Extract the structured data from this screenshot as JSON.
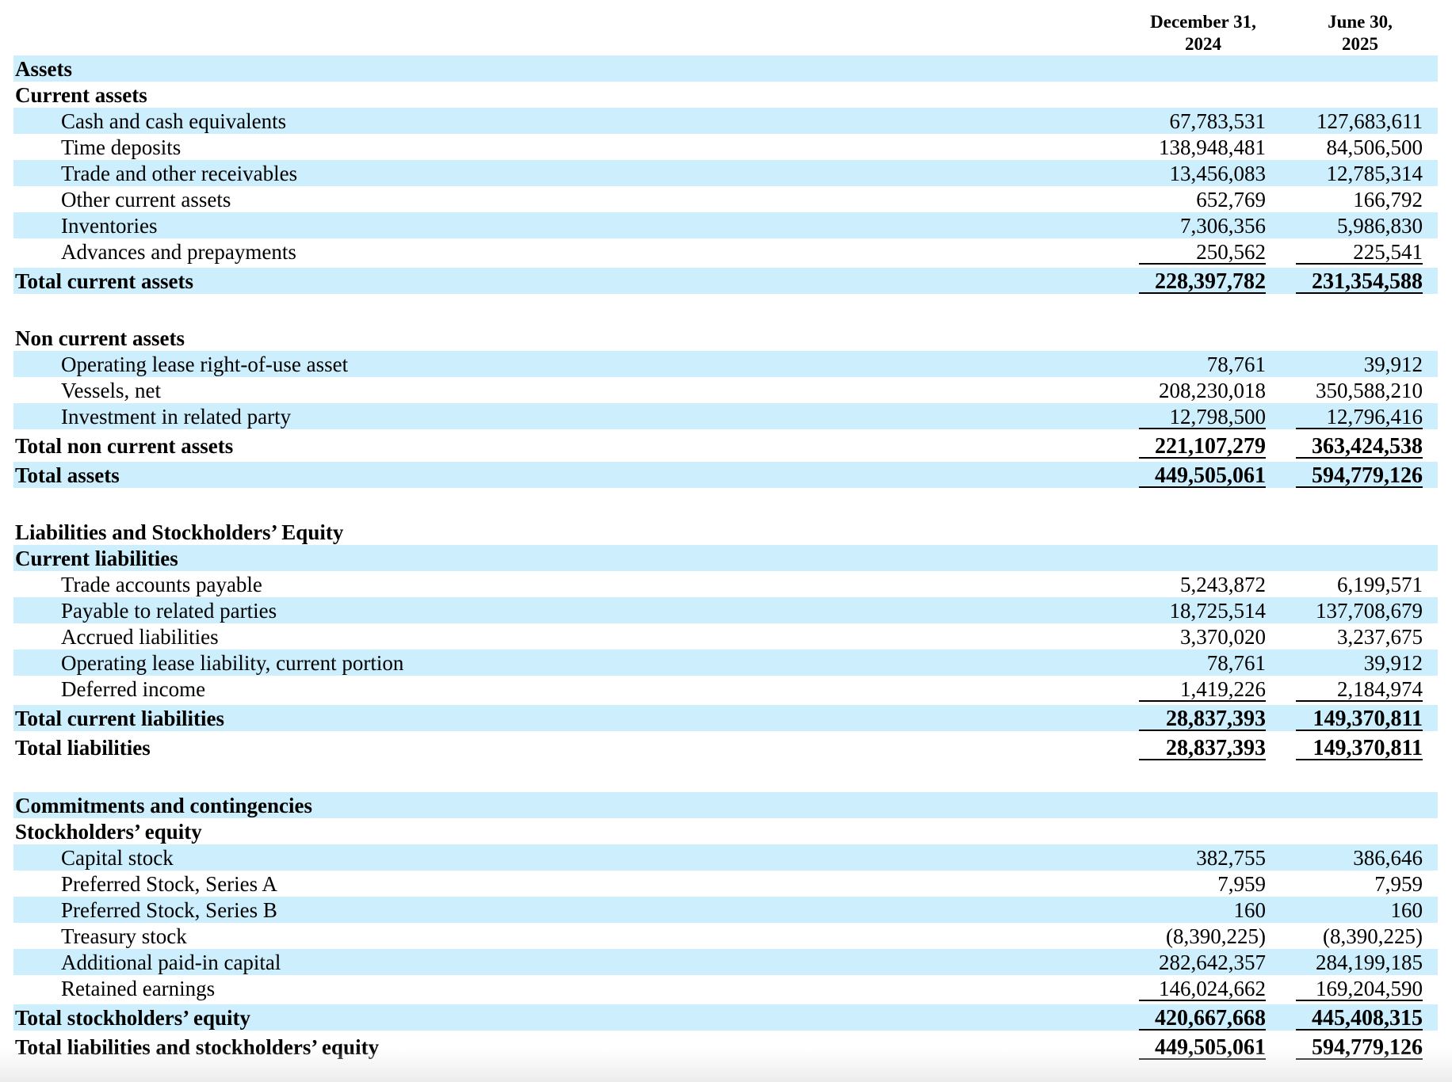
{
  "columns": [
    "December 31,\n2024",
    "June 30,\n2025"
  ],
  "column_lines": [
    [
      "December 31,",
      "2024"
    ],
    [
      "June 30,",
      "2025"
    ]
  ],
  "rows": [
    {
      "label": "Assets",
      "v1": "",
      "v2": ""
    },
    {
      "label": "Current assets",
      "v1": "",
      "v2": ""
    },
    {
      "label": "Cash and cash equivalents",
      "v1": "67,783,531",
      "v2": "127,683,611"
    },
    {
      "label": "Time deposits",
      "v1": "138,948,481",
      "v2": "84,506,500"
    },
    {
      "label": "Trade and other receivables",
      "v1": "13,456,083",
      "v2": "12,785,314"
    },
    {
      "label": "Other current assets",
      "v1": "652,769",
      "v2": "166,792"
    },
    {
      "label": "Inventories",
      "v1": "7,306,356",
      "v2": "5,986,830"
    },
    {
      "label": "Advances and prepayments",
      "v1": "250,562",
      "v2": "225,541"
    },
    {
      "label": "Total current assets",
      "v1": "228,397,782",
      "v2": "231,354,588"
    },
    {
      "label": "Non current assets",
      "v1": "",
      "v2": ""
    },
    {
      "label": "Operating lease right-of-use asset",
      "v1": "78,761",
      "v2": "39,912"
    },
    {
      "label": "Vessels, net",
      "v1": "208,230,018",
      "v2": "350,588,210"
    },
    {
      "label": "Investment in related party",
      "v1": "12,798,500",
      "v2": "12,796,416"
    },
    {
      "label": "Total non current assets",
      "v1": "221,107,279",
      "v2": "363,424,538"
    },
    {
      "label": "Total assets",
      "v1": "449,505,061",
      "v2": "594,779,126"
    },
    {
      "label": "Liabilities and Stockholders’ Equity",
      "v1": "",
      "v2": ""
    },
    {
      "label": "Current liabilities",
      "v1": "",
      "v2": ""
    },
    {
      "label": "Trade accounts payable",
      "v1": "5,243,872",
      "v2": "6,199,571"
    },
    {
      "label": "Payable to related parties",
      "v1": "18,725,514",
      "v2": "137,708,679"
    },
    {
      "label": "Accrued liabilities",
      "v1": "3,370,020",
      "v2": "3,237,675"
    },
    {
      "label": "Operating lease liability, current portion",
      "v1": "78,761",
      "v2": "39,912"
    },
    {
      "label": "Deferred income",
      "v1": "1,419,226",
      "v2": "2,184,974"
    },
    {
      "label": "Total current liabilities",
      "v1": "28,837,393",
      "v2": "149,370,811"
    },
    {
      "label": "Total liabilities",
      "v1": "28,837,393",
      "v2": "149,370,811"
    },
    {
      "label": "Commitments and contingencies",
      "v1": "",
      "v2": ""
    },
    {
      "label": "Stockholders’ equity",
      "v1": "",
      "v2": ""
    },
    {
      "label": "Capital stock",
      "v1": "382,755",
      "v2": "386,646"
    },
    {
      "label": "Preferred Stock, Series A",
      "v1": "7,959",
      "v2": "7,959"
    },
    {
      "label": "Preferred Stock, Series B",
      "v1": "160",
      "v2": "160"
    },
    {
      "label": "Treasury stock",
      "v1": "(8,390,225)",
      "v2": "(8,390,225)"
    },
    {
      "label": "Additional paid-in capital",
      "v1": "282,642,357",
      "v2": "284,199,185"
    },
    {
      "label": "Retained earnings",
      "v1": "146,024,662",
      "v2": "169,204,590"
    },
    {
      "label": "Total stockholders’ equity",
      "v1": "420,667,668",
      "v2": "445,408,315"
    },
    {
      "label": "Total liabilities and stockholders’ equity",
      "v1": "449,505,061",
      "v2": "594,779,126"
    }
  ],
  "colors": {
    "row_shade": "#cdeefc",
    "text": "#000000"
  }
}
